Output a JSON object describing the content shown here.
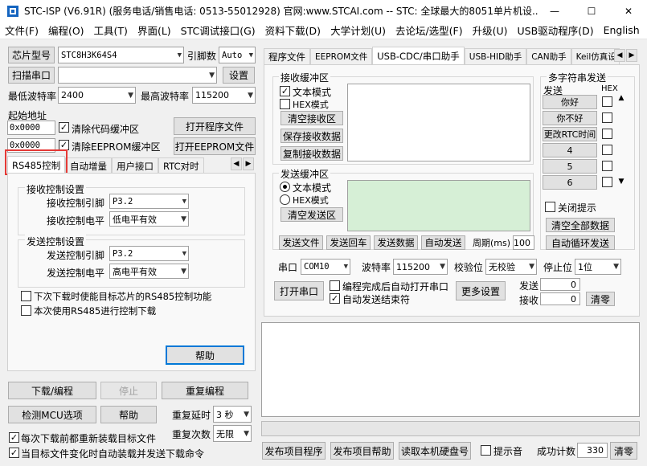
{
  "window": {
    "title": "STC-ISP (V6.91R) (服务电话/销售电话: 0513-55012928) 官网:www.STCAI.com  -- STC: 全球最大的8051单片机设...",
    "minimize": "—",
    "maximize": "☐",
    "close": "✕"
  },
  "menu": [
    "文件(F)",
    "编程(O)",
    "工具(T)",
    "界面(L)",
    "STC调试接口(G)",
    "资料下载(D)",
    "大学计划(U)",
    "去论坛/选型(F)",
    "升级(U)",
    "USB驱动程序(D)",
    "English"
  ],
  "left": {
    "chip_label": "芯片型号",
    "chip_value": "STC8H3K64S4",
    "pin_label": "引脚数",
    "pin_value": "Auto",
    "scan_button": "扫描串口",
    "port_value": "",
    "settings_button": "设置",
    "min_baud_label": "最低波特率",
    "min_baud_value": "2400",
    "max_baud_label": "最高波特率",
    "max_baud_value": "115200",
    "start_addr_label": "起始地址",
    "addr1": "0x0000",
    "clear_code_label": "清除代码缓冲区",
    "open_program_button": "打开程序文件",
    "addr2": "0x0000",
    "clear_eeprom_label": "清除EEPROM缓冲区",
    "open_eeprom_button": "打开EEPROM文件",
    "tabs": [
      "RS485控制",
      "自动增量",
      "用户接口",
      "RTC对时"
    ],
    "recv_group": "接收控制设置",
    "recv_pin_label": "接收控制引脚",
    "recv_pin_value": "P3.2",
    "recv_level_label": "接收控制电平",
    "recv_level_value": "低电平有效",
    "send_group": "发送控制设置",
    "send_pin_label": "发送控制引脚",
    "send_pin_value": "P3.2",
    "send_level_label": "发送控制电平",
    "send_level_value": "高电平有效",
    "enable_next_label": "下次下载时使能目标芯片的RS485控制功能",
    "use_this_label": "本次使用RS485进行控制下载",
    "help_button": "帮助",
    "download_button": "下载/编程",
    "stop_button": "停止",
    "reprogram_button": "重复编程",
    "check_mcu_button": "检测MCU选项",
    "help2_button": "帮助",
    "repeat_delay_label": "重复延时",
    "repeat_delay_value": "3 秒",
    "reload_label": "每次下载前都重新装载目标文件",
    "repeat_count_label": "重复次数",
    "repeat_count_value": "无限",
    "auto_load_label": "当目标文件变化时自动装载并发送下载命令"
  },
  "right": {
    "tabs": [
      "程序文件",
      "EEPROM文件",
      "USB-CDC/串口助手",
      "USB-HID助手",
      "CAN助手",
      "Keil仿真设"
    ],
    "recv_group": "接收缓冲区",
    "recv_text_mode": "文本模式",
    "recv_hex_mode": "HEX模式",
    "clear_recv_button": "清空接收区",
    "save_recv_button": "保存接收数据",
    "copy_recv_button": "复制接收数据",
    "send_group": "发送缓冲区",
    "send_text_mode": "文本模式",
    "send_hex_mode": "HEX模式",
    "clear_send_button": "清空发送区",
    "send_file_button": "发送文件",
    "send_enter_button": "发送回车",
    "send_data_button": "发送数据",
    "auto_send_button": "自动发送",
    "period_label": "周期(ms)",
    "period_value": "100",
    "multi_group": "多字符串发送",
    "send_col": "发送",
    "hex_col": "HEX",
    "multi_items": [
      "你好",
      "你不好",
      "更改RTC时间",
      "4",
      "5",
      "6"
    ],
    "close_tip_label": "关闭提示",
    "clear_all_button": "清空全部数据",
    "auto_loop_button": "自动循环发送",
    "port_label": "串口",
    "port_value": "COM10",
    "baud_label": "波特率",
    "baud_value": "115200",
    "parity_label": "校验位",
    "parity_value": "无校验",
    "stopbit_label": "停止位",
    "stopbit_value": "1位",
    "open_port_button": "打开串口",
    "auto_open_label": "编程完成后自动打开串口",
    "auto_send_end_label": "自动发送结束符",
    "more_settings_button": "更多设置",
    "send_count_label": "发送",
    "send_count_value": "0",
    "recv_count_label": "接收",
    "recv_count_value": "0",
    "clear_count_button": "清零"
  },
  "bottom": {
    "publish_program_button": "发布项目程序",
    "publish_help_button": "发布项目帮助",
    "read_disk_button": "读取本机硬盘号",
    "beep_label": "提示音",
    "success_label": "成功计数",
    "success_value": "330",
    "clear_success_button": "清零"
  },
  "colors": {
    "highlight": "#e53935",
    "send_area": "#d6efd6",
    "accent": "#0078d7"
  }
}
